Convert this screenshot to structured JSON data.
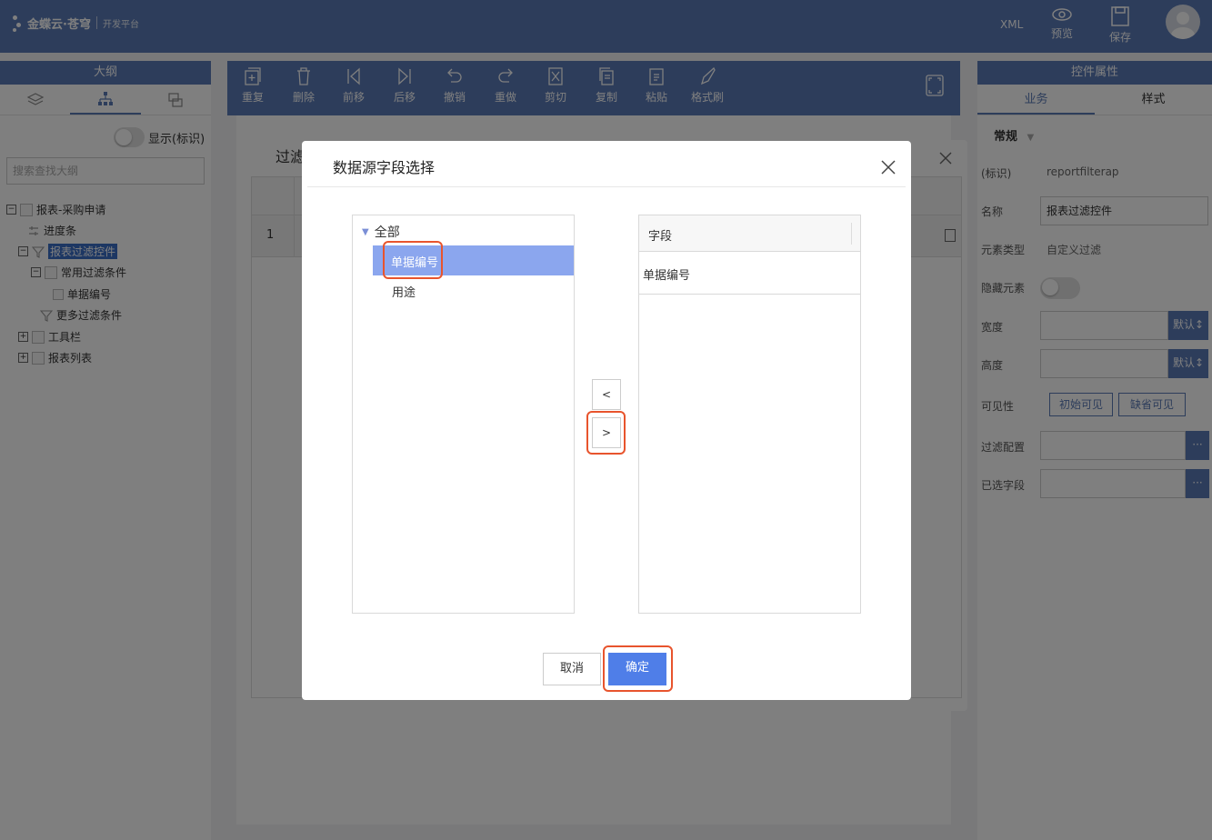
{
  "header": {
    "logo_text": "金蝶云·苍穹",
    "logo_sub": "开发平台",
    "xml_label": "XML",
    "preview_label": "预览",
    "save_label": "保存"
  },
  "left_panel": {
    "title": "大纲",
    "show_label": "显示(标识)",
    "search_placeholder": "搜索查找大纲",
    "tree": [
      {
        "label": "报表-采购申请",
        "toggle": "−"
      },
      {
        "label": "进度条"
      },
      {
        "label": "报表过滤控件",
        "toggle": "−"
      },
      {
        "label": "常用过滤条件",
        "toggle": "−"
      },
      {
        "label": "单据编号"
      },
      {
        "label": "更多过滤条件"
      },
      {
        "label": "工具栏",
        "toggle": "+"
      },
      {
        "label": "报表列表",
        "toggle": "+"
      }
    ]
  },
  "toolbar": {
    "items": [
      "重复",
      "删除",
      "前移",
      "后移",
      "撤销",
      "重做",
      "剪切",
      "复制",
      "粘贴",
      "格式刷"
    ]
  },
  "right_panel": {
    "title": "控件属性",
    "tab_business": "业务",
    "tab_style": "样式",
    "section": "常规",
    "props": {
      "id_label": "(标识)",
      "id_value": "reportfilterap",
      "name_label": "名称",
      "name_value": "报表过滤控件",
      "type_label": "元素类型",
      "type_value": "自定义过滤",
      "hidden_label": "隐藏元素",
      "width_label": "宽度",
      "height_label": "高度",
      "default_label": "默认",
      "visible_label": "可见性",
      "visible_init": "初始可见",
      "visible_default": "缺省可见",
      "filter_label": "过滤配置",
      "selected_label": "已选字段",
      "dots": "···"
    }
  },
  "behind_dialog": {
    "title": "过滤",
    "row_no": "1"
  },
  "dialog": {
    "title": "数据源字段选择",
    "tree_root": "全部",
    "tree_items": [
      "单据编号",
      "用途"
    ],
    "column_header": "字段",
    "selected_fields": [
      "单据编号"
    ],
    "move_left": "<",
    "move_right": ">",
    "cancel_label": "取消",
    "ok_label": "确定"
  },
  "colors": {
    "brand": "#5a7ab7",
    "selected_row": "#8ba6ee",
    "primary_button": "#4f7ee8",
    "annotation_red": "#e8542d"
  }
}
